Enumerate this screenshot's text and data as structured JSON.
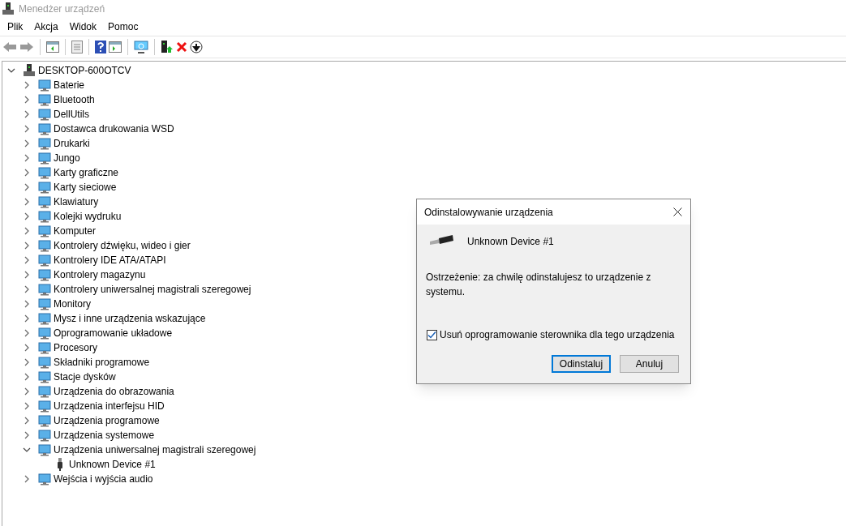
{
  "window": {
    "title": "Menedżer urządzeń"
  },
  "menu": [
    "Plik",
    "Akcja",
    "Widok",
    "Pomoc"
  ],
  "tree": {
    "label": "DESKTOP-600OTCV",
    "expanded": true,
    "children": [
      {
        "label": "Baterie",
        "expanded": false
      },
      {
        "label": "Bluetooth",
        "expanded": false
      },
      {
        "label": "DellUtils",
        "expanded": false
      },
      {
        "label": "Dostawca drukowania WSD",
        "expanded": false
      },
      {
        "label": "Drukarki",
        "expanded": false
      },
      {
        "label": "Jungo",
        "expanded": false
      },
      {
        "label": "Karty graficzne",
        "expanded": false
      },
      {
        "label": "Karty sieciowe",
        "expanded": false
      },
      {
        "label": "Klawiatury",
        "expanded": false
      },
      {
        "label": "Kolejki wydruku",
        "expanded": false
      },
      {
        "label": "Komputer",
        "expanded": false
      },
      {
        "label": "Kontrolery dźwięku, wideo i gier",
        "expanded": false
      },
      {
        "label": "Kontrolery IDE ATA/ATAPI",
        "expanded": false
      },
      {
        "label": "Kontrolery magazynu",
        "expanded": false
      },
      {
        "label": "Kontrolery uniwersalnej magistrali szeregowej",
        "expanded": false
      },
      {
        "label": "Monitory",
        "expanded": false
      },
      {
        "label": "Mysz i inne urządzenia wskazujące",
        "expanded": false
      },
      {
        "label": "Oprogramowanie układowe",
        "expanded": false
      },
      {
        "label": "Procesory",
        "expanded": false
      },
      {
        "label": "Składniki programowe",
        "expanded": false
      },
      {
        "label": "Stacje dysków",
        "expanded": false
      },
      {
        "label": "Urządzenia do obrazowania",
        "expanded": false
      },
      {
        "label": "Urządzenia interfejsu HID",
        "expanded": false
      },
      {
        "label": "Urządzenia programowe",
        "expanded": false
      },
      {
        "label": "Urządzenia systemowe",
        "expanded": false
      },
      {
        "label": "Urządzenia uniwersalnej magistrali szeregowej",
        "expanded": true,
        "children": [
          {
            "label": "Unknown Device #1"
          }
        ]
      },
      {
        "label": "Wejścia i wyjścia audio",
        "expanded": false
      }
    ]
  },
  "dialog": {
    "title": "Odinstalowywanie urządzenia",
    "device": "Unknown Device #1",
    "warning": "Ostrzeżenie: za chwilę odinstalujesz to urządzenie z systemu.",
    "checkbox": {
      "label": "Usuń oprogramowanie sterownika dla tego urządzenia",
      "checked": true
    },
    "buttons": [
      {
        "label": "Odinstaluj",
        "default": true
      },
      {
        "label": "Anuluj",
        "default": false
      }
    ]
  }
}
